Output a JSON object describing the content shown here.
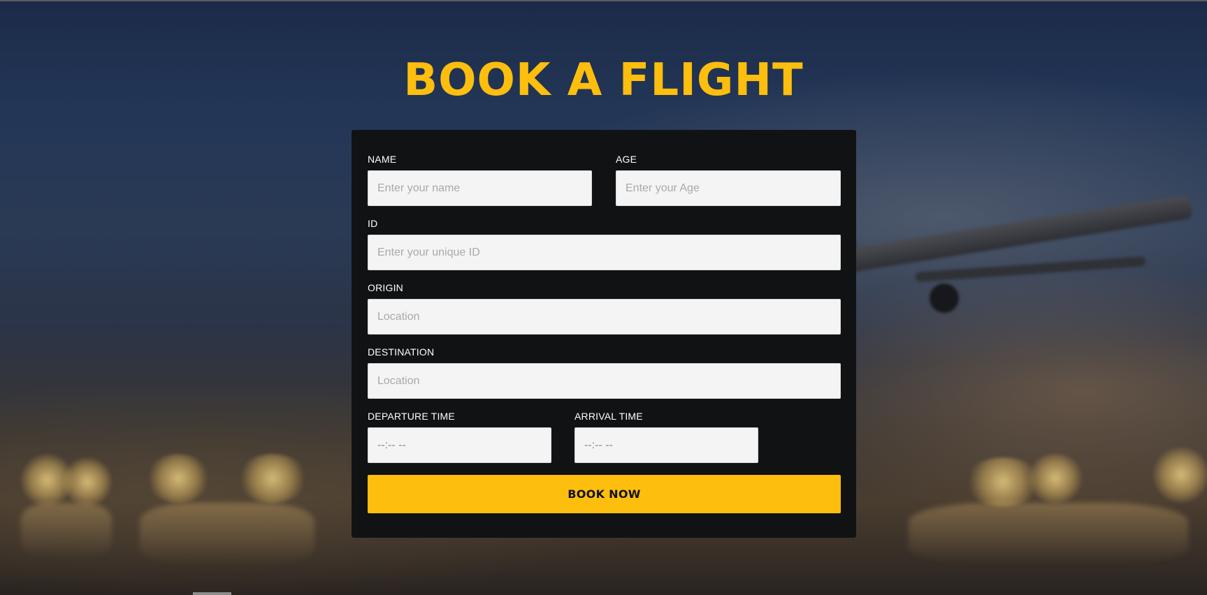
{
  "page": {
    "title": "BOOK A FLIGHT"
  },
  "form": {
    "name": {
      "label": "NAME",
      "placeholder": "Enter your name"
    },
    "age": {
      "label": "AGE",
      "placeholder": "Enter your Age"
    },
    "id": {
      "label": "ID",
      "placeholder": "Enter your unique ID"
    },
    "origin": {
      "label": "ORIGIN",
      "placeholder": "Location"
    },
    "destination": {
      "label": "DESTINATION",
      "placeholder": "Location"
    },
    "departure_time": {
      "label": "DEPARTURE TIME",
      "value": "--:-- --"
    },
    "arrival_time": {
      "label": "ARRIVAL TIME",
      "value": "--:-- --"
    },
    "submit_label": "BOOK NOW"
  },
  "colors": {
    "accent": "#fdbe0e",
    "card": "#111214",
    "input_bg": "#f4f4f4"
  }
}
